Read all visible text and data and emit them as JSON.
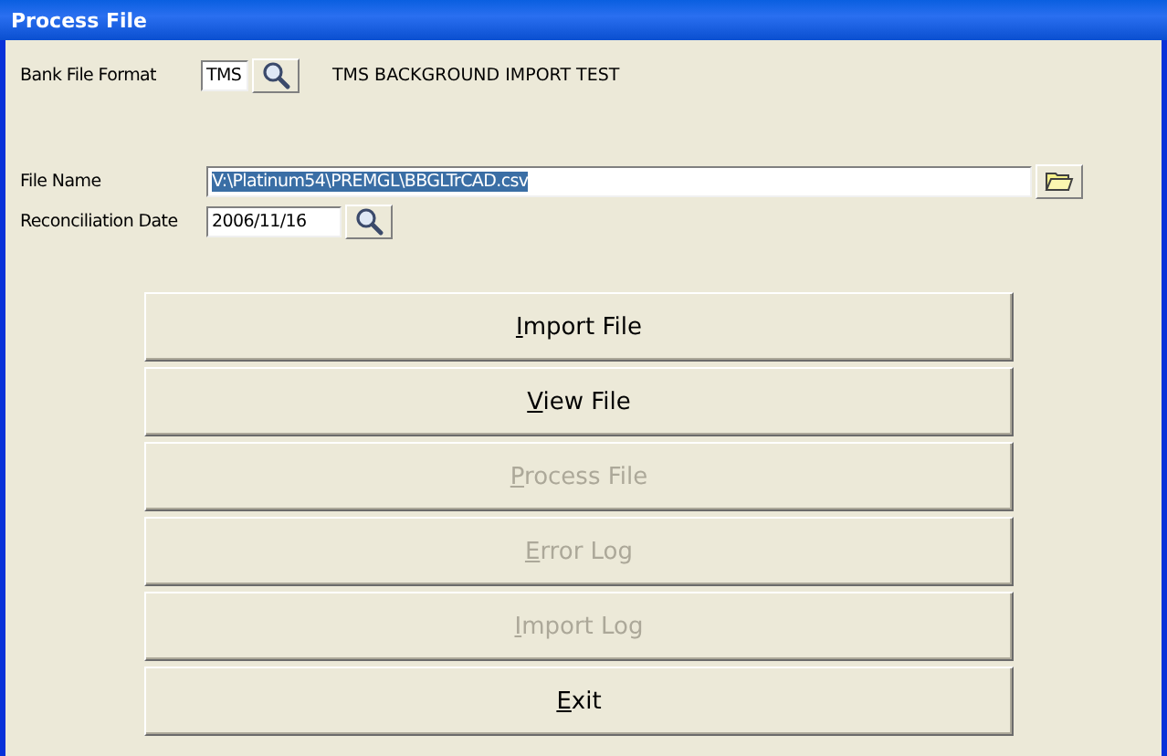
{
  "window": {
    "title": "Process File"
  },
  "bank_file_format": {
    "label": "Bank File Format",
    "value": "TMS",
    "description": "TMS BACKGROUND IMPORT TEST"
  },
  "file_name": {
    "label": "File Name",
    "value": "V:\\Platinum54\\PREMGL\\BBGLTrCAD.csv",
    "selected": true
  },
  "reconciliation_date": {
    "label": "Reconciliation Date",
    "value": "2006/11/16"
  },
  "buttons": [
    {
      "key": "I",
      "rest": "mport File",
      "disabled": false
    },
    {
      "key": "V",
      "rest": "iew File",
      "disabled": false
    },
    {
      "key": "P",
      "rest": "rocess File",
      "disabled": true
    },
    {
      "key": "E",
      "rest": "rror Log",
      "disabled": true
    },
    {
      "key": "I",
      "rest": "mport Log",
      "disabled": true
    },
    {
      "key": "E",
      "rest": "xit",
      "disabled": false
    }
  ]
}
